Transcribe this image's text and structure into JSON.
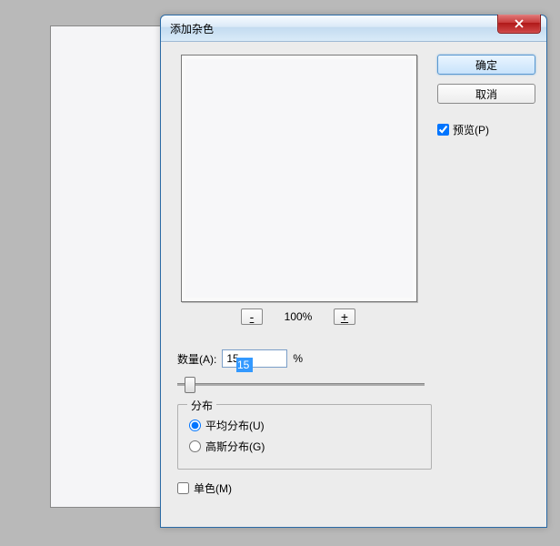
{
  "dialog": {
    "title": "添加杂色",
    "ok_label": "确定",
    "cancel_label": "取消",
    "preview_label": "预览(P)",
    "preview_checked": true,
    "zoom": {
      "minus": "-",
      "plus": "+",
      "value": "100%"
    },
    "amount": {
      "label": "数量(A):",
      "value": "15",
      "unit": "%"
    },
    "distribution": {
      "legend": "分布",
      "uniform_label": "平均分布(U)",
      "gaussian_label": "高斯分布(G)",
      "selected": "uniform"
    },
    "mono": {
      "label": "单色(M)",
      "checked": false
    }
  }
}
